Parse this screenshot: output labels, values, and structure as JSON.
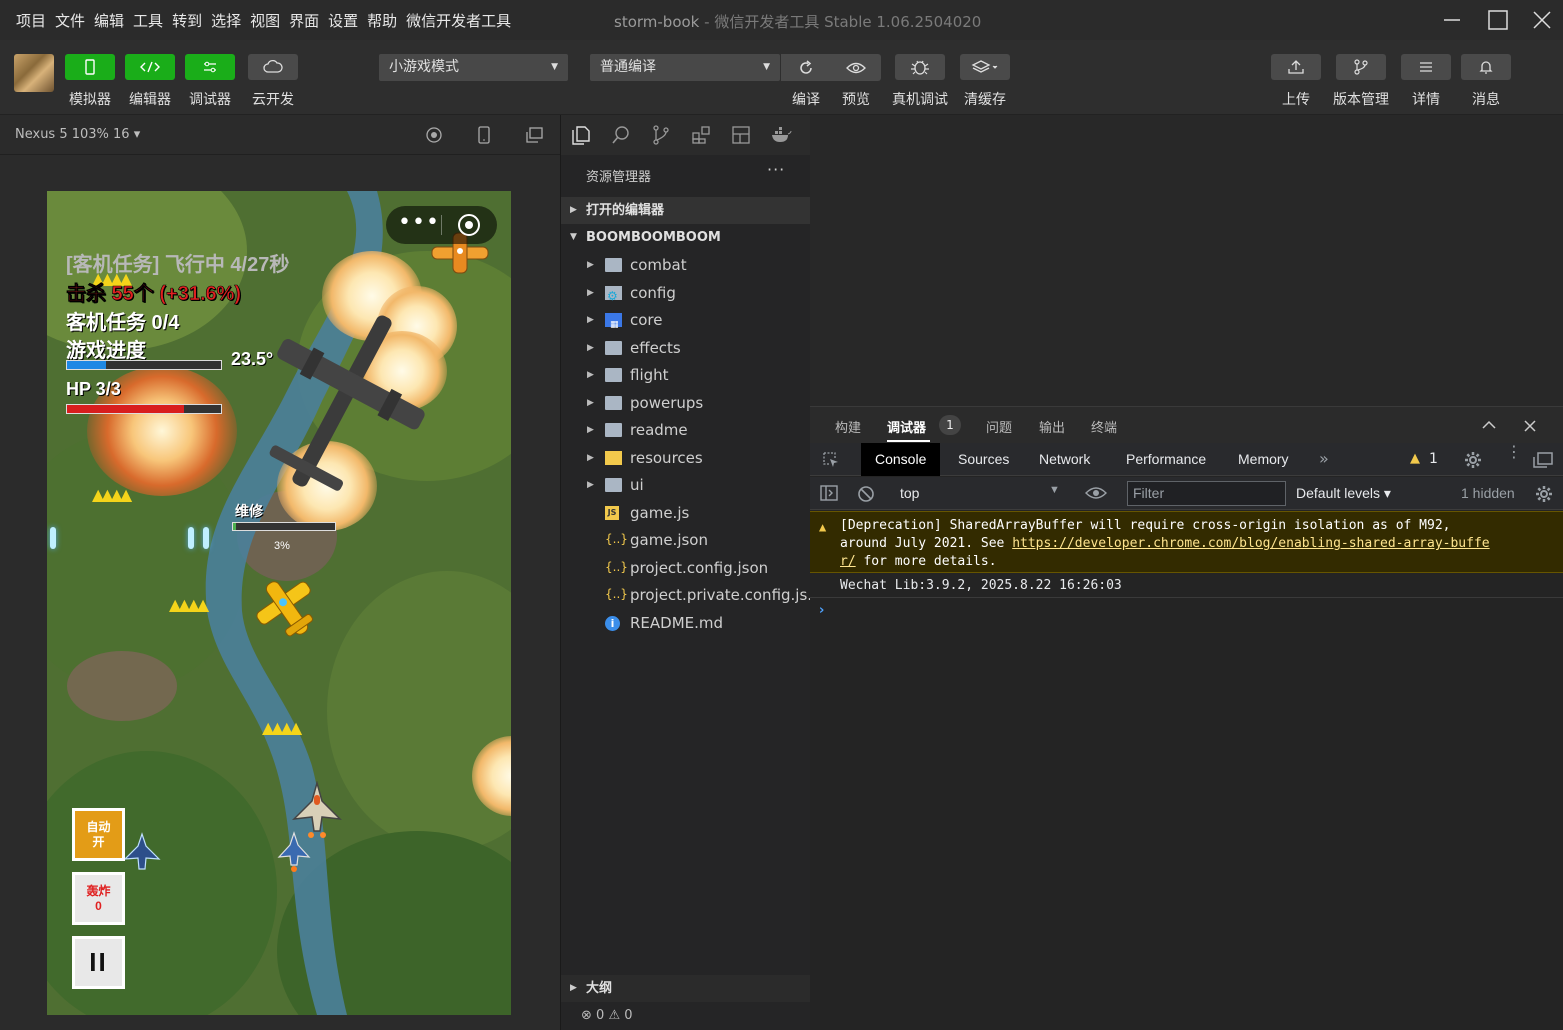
{
  "menubar": {
    "items": [
      "项目",
      "文件",
      "编辑",
      "工具",
      "转到",
      "选择",
      "视图",
      "界面",
      "设置",
      "帮助",
      "微信开发者工具"
    ],
    "title": "storm-book",
    "version": " - 微信开发者工具 Stable 1.06.2504020"
  },
  "toolbar": {
    "simulator": "模拟器",
    "editor": "编辑器",
    "debugger": "调试器",
    "cloud": "云开发",
    "mode_select": "小游戏模式",
    "compile_select": "普通编译",
    "compile": "编译",
    "preview": "预览",
    "device_debug": "真机调试",
    "clear_cache": "清缓存",
    "upload": "上传",
    "version_mgmt": "版本管理",
    "details": "详情",
    "messages": "消息"
  },
  "simulator": {
    "device": "Nexus 5 103% 16 ▾"
  },
  "game": {
    "mission_status": "[客机任务] 飞行中 4/27秒",
    "kills": "击杀 55个 (+31.6%)",
    "passenger_mission": "客机任务 0/4",
    "progress_label": "游戏进度",
    "progress_value": "23.5°",
    "progress_fraction": 0.25,
    "hp_label": "HP 3/3",
    "hp_fraction": 0.76,
    "repair_label": "维修",
    "repair_percent": "3%",
    "repair_fraction": 0.03,
    "auto_button_line1": "自动",
    "auto_button_line2": "开",
    "bomb_button_line1": "轰炸",
    "bomb_button_line2": "0",
    "pause_symbol": "II",
    "capsule_dots": "•••"
  },
  "explorer": {
    "title": "资源管理器",
    "more": "···",
    "open_editors": "打开的编辑器",
    "project": "BOOMBOOMBOOM",
    "items": [
      {
        "name": "combat",
        "type": "folder"
      },
      {
        "name": "config",
        "type": "config-folder"
      },
      {
        "name": "core",
        "type": "core-folder"
      },
      {
        "name": "effects",
        "type": "folder"
      },
      {
        "name": "flight",
        "type": "folder"
      },
      {
        "name": "powerups",
        "type": "folder"
      },
      {
        "name": "readme",
        "type": "folder"
      },
      {
        "name": "resources",
        "type": "resources-folder"
      },
      {
        "name": "ui",
        "type": "folder"
      },
      {
        "name": "game.js",
        "type": "js"
      },
      {
        "name": "game.json",
        "type": "json"
      },
      {
        "name": "project.config.json",
        "type": "json"
      },
      {
        "name": "project.private.config.js...",
        "type": "json"
      },
      {
        "name": "README.md",
        "type": "info"
      }
    ],
    "outline": "大纲",
    "errors": "0",
    "warnings": "0"
  },
  "debugger": {
    "tabs": [
      "构建",
      "调试器",
      "问题",
      "输出",
      "终端"
    ],
    "badge": "1",
    "devtools_tabs": [
      "Console",
      "Sources",
      "Network",
      "Performance",
      "Memory"
    ],
    "warning_count": "1",
    "context": "top",
    "filter_placeholder": "Filter",
    "levels": "Default levels ▾",
    "hidden": "1 hidden",
    "warning_text_1": "[Deprecation] SharedArrayBuffer will require cross-origin isolation as of M92,",
    "warning_text_2": "around July 2021. See ",
    "warning_link_1": "https://developer.chrome.com/blog/enabling-shared-array-buffe",
    "warning_link_2": "r/",
    "warning_text_3": " for more details.",
    "log_line": "Wechat Lib:3.9.2, 2025.8.22 16:26:03",
    "prompt": "›"
  },
  "colors": {
    "green": "#1aad19",
    "kills_red": "#e02020",
    "hp_red": "#d81e1e",
    "progress_blue": "#1e88e5",
    "auto_button": "#e39c17",
    "bomb_button": "#e8e8e8"
  }
}
